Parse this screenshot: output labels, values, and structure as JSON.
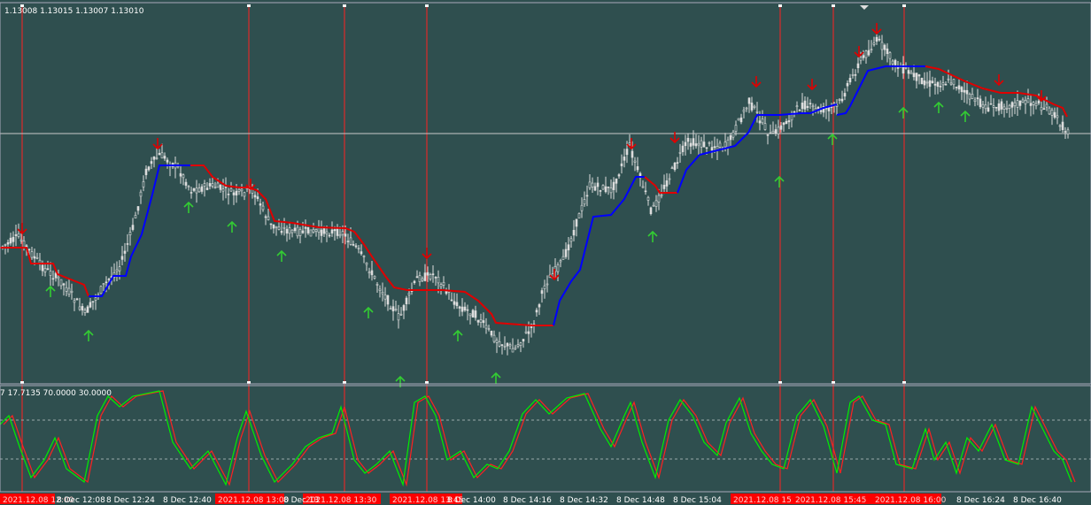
{
  "main_panel": {
    "ohlc_readout": "1.13008 1.13015 1.13007 1.13010"
  },
  "oscillator_panel": {
    "readout": "7 17.7135 70.0000 30.0000"
  },
  "time_axis": {
    "labels": [
      "8 Dec 12:08",
      "8 Dec 12:24",
      "8 Dec 12:40",
      "8 Dec 13",
      "8 Dec 14:00",
      "8 Dec 14:16",
      "8 Dec 14:32",
      "8 Dec 14:48",
      "8 Dec 15:04",
      "8 Dec 16:24",
      "8 Dec 16:40"
    ],
    "highlight_labels": [
      "2021.12.08 12:00",
      "2021.12.08 13:00",
      "2021.12.08 13:30",
      "2021.12.08 13:45",
      "2021.12.08 15:30",
      "2021.12.08 15:45",
      "2021.12.08 16:00"
    ]
  },
  "colors": {
    "background": "#2f4f4f",
    "candle": "#dcdcdc",
    "line_up": "#0000ff",
    "line_down": "#e00000",
    "arrow_up": "#33cc33",
    "arrow_down": "#e00000",
    "vline": "#ff2020",
    "osc_main": "#00ee00",
    "osc_signal": "#ff2020",
    "highlight": "#ff0000"
  },
  "icons": {
    "arrow_up": "buy-arrow-icon",
    "arrow_down": "sell-arrow-icon",
    "scroll_marker": "shift-triangle-icon"
  }
}
